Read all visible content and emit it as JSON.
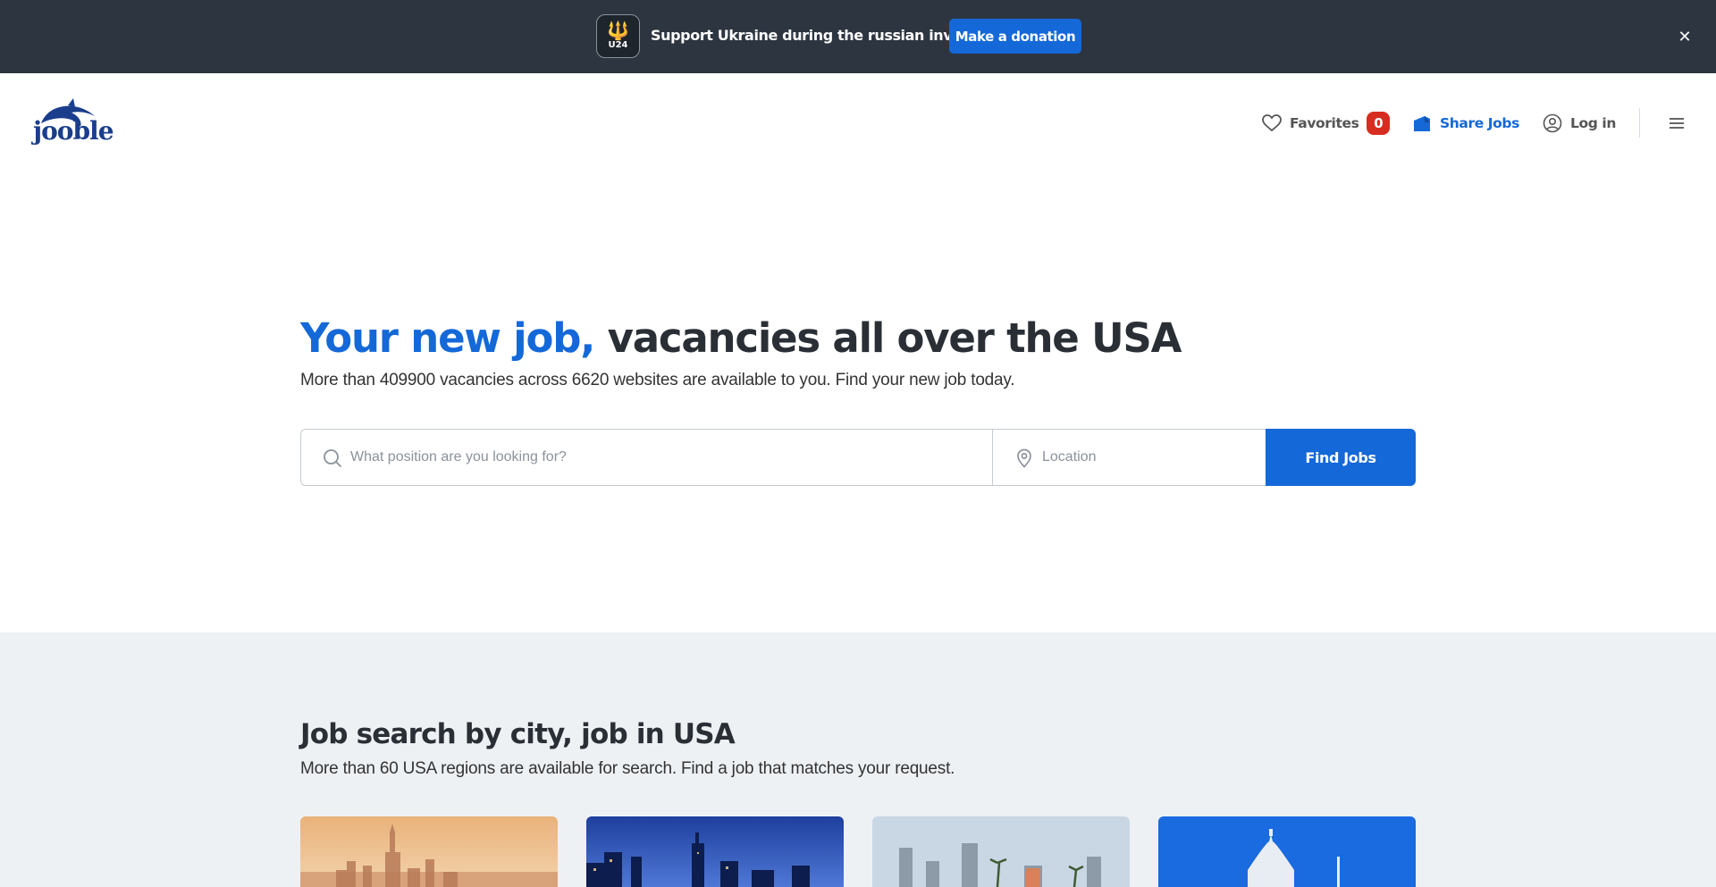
{
  "banner": {
    "badge_text": "U24",
    "message": "Support Ukraine during the russian invasion",
    "donate_label": "Make a donation"
  },
  "header": {
    "logo_text": "jooble",
    "favorites_label": "Favorites",
    "favorites_count": "0",
    "share_label": "Share Jobs",
    "login_label": "Log in"
  },
  "hero": {
    "title_highlight": "Your new job,",
    "title_rest": " vacancies all over the USA",
    "subtitle": "More than 409900 vacancies across 6620 websites are available to you. Find your new job today."
  },
  "search": {
    "keyword_placeholder": "What position are you looking for?",
    "keyword_value": "",
    "location_placeholder": "Location",
    "location_value": "",
    "button_label": "Find Jobs"
  },
  "cities": {
    "title": "Job search by city, job in USA",
    "subtitle": "More than 60 USA regions are available for search. Find a job that matches your request.",
    "cards": [
      {
        "image": "new-york-skyline"
      },
      {
        "image": "chicago-skyline"
      },
      {
        "image": "los-angeles-skyline"
      },
      {
        "image": "washington-capitol"
      }
    ]
  },
  "colors": {
    "accent": "#1468d8",
    "banner_bg": "#2d3540",
    "badge_red": "#d62d20",
    "section_bg": "#eef1f4"
  }
}
